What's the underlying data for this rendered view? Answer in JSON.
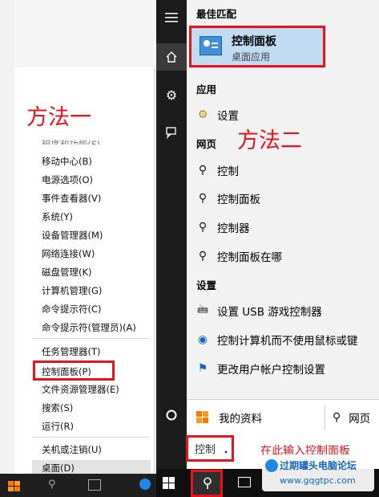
{
  "annotations": {
    "method1": "方法一",
    "method2": "方法二"
  },
  "context_menu": {
    "items": [
      {
        "label": "移动中心(B)"
      },
      {
        "label": "电源选项(O)"
      },
      {
        "label": "事件查看器(V)"
      },
      {
        "label": "系统(Y)"
      },
      {
        "label": "设备管理器(M)"
      },
      {
        "label": "网络连接(W)"
      },
      {
        "label": "磁盘管理(K)"
      },
      {
        "label": "计算机管理(G)"
      },
      {
        "label": "命令提示符(C)"
      },
      {
        "label": "命令提示符(管理员)(A)"
      }
    ],
    "items2": [
      {
        "label": "任务管理器(T)"
      },
      {
        "label": "控制面板(P)"
      },
      {
        "label": "文件资源管理器(E)"
      },
      {
        "label": "搜索(S)"
      },
      {
        "label": "运行(R)"
      }
    ],
    "items3": [
      {
        "label": "关机或注销(U)"
      },
      {
        "label": "桌面(D)"
      }
    ]
  },
  "start_menu": {
    "best_match_title": "最佳匹配",
    "best_match": {
      "title": "控制面板",
      "subtitle": "桌面应用"
    },
    "apps_title": "应用",
    "apps": [
      {
        "label": "设置"
      }
    ],
    "web_title": "网页",
    "web": [
      {
        "label": "控制"
      },
      {
        "label": "控制面板"
      },
      {
        "label": "控制器"
      },
      {
        "label": "控制面板在哪"
      }
    ],
    "settings_title": "设置",
    "settings": [
      {
        "label": "设置 USB 游戏控制器"
      },
      {
        "label": "控制计算机而不使用鼠标或键"
      },
      {
        "label": "更改用户帐户控制设置"
      }
    ],
    "my_info_label": "我的资料",
    "web_tab_label": "网页",
    "search_value": "控制",
    "search_hint": "在此输入控制面板"
  },
  "watermark": {
    "line1": "过期罐头电脑论坛",
    "line2": "www.gqgtpc.com"
  }
}
